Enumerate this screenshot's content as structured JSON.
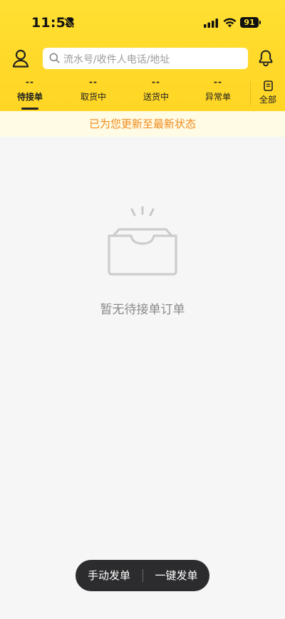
{
  "status_bar": {
    "time": "11:53",
    "battery": "91",
    "icons": [
      "bell-slash-icon",
      "signal-icon",
      "wifi-icon",
      "battery-icon"
    ]
  },
  "header": {
    "profile_icon": "person-icon",
    "search_placeholder": "流水号/收件人电话/地址",
    "search_icon": "search-icon",
    "bell_icon": "bell-icon",
    "background_color": "#ffd92a"
  },
  "tabs": [
    {
      "count": "--",
      "label": "待接单",
      "active": true
    },
    {
      "count": "--",
      "label": "取货中",
      "active": false
    },
    {
      "count": "--",
      "label": "送货中",
      "active": false
    },
    {
      "count": "--",
      "label": "异常单",
      "active": false
    }
  ],
  "all_tab": {
    "label": "全部",
    "icon": "document-icon"
  },
  "notice": {
    "text": "已为您更新至最新状态",
    "color": "#f08a1c"
  },
  "empty_state": {
    "icon": "empty-tray-icon",
    "text": "暂无待接单订单"
  },
  "dispatch": {
    "manual_label": "手动发单",
    "oneclick_label": "一键发单",
    "background_color": "#2c2c2e"
  }
}
